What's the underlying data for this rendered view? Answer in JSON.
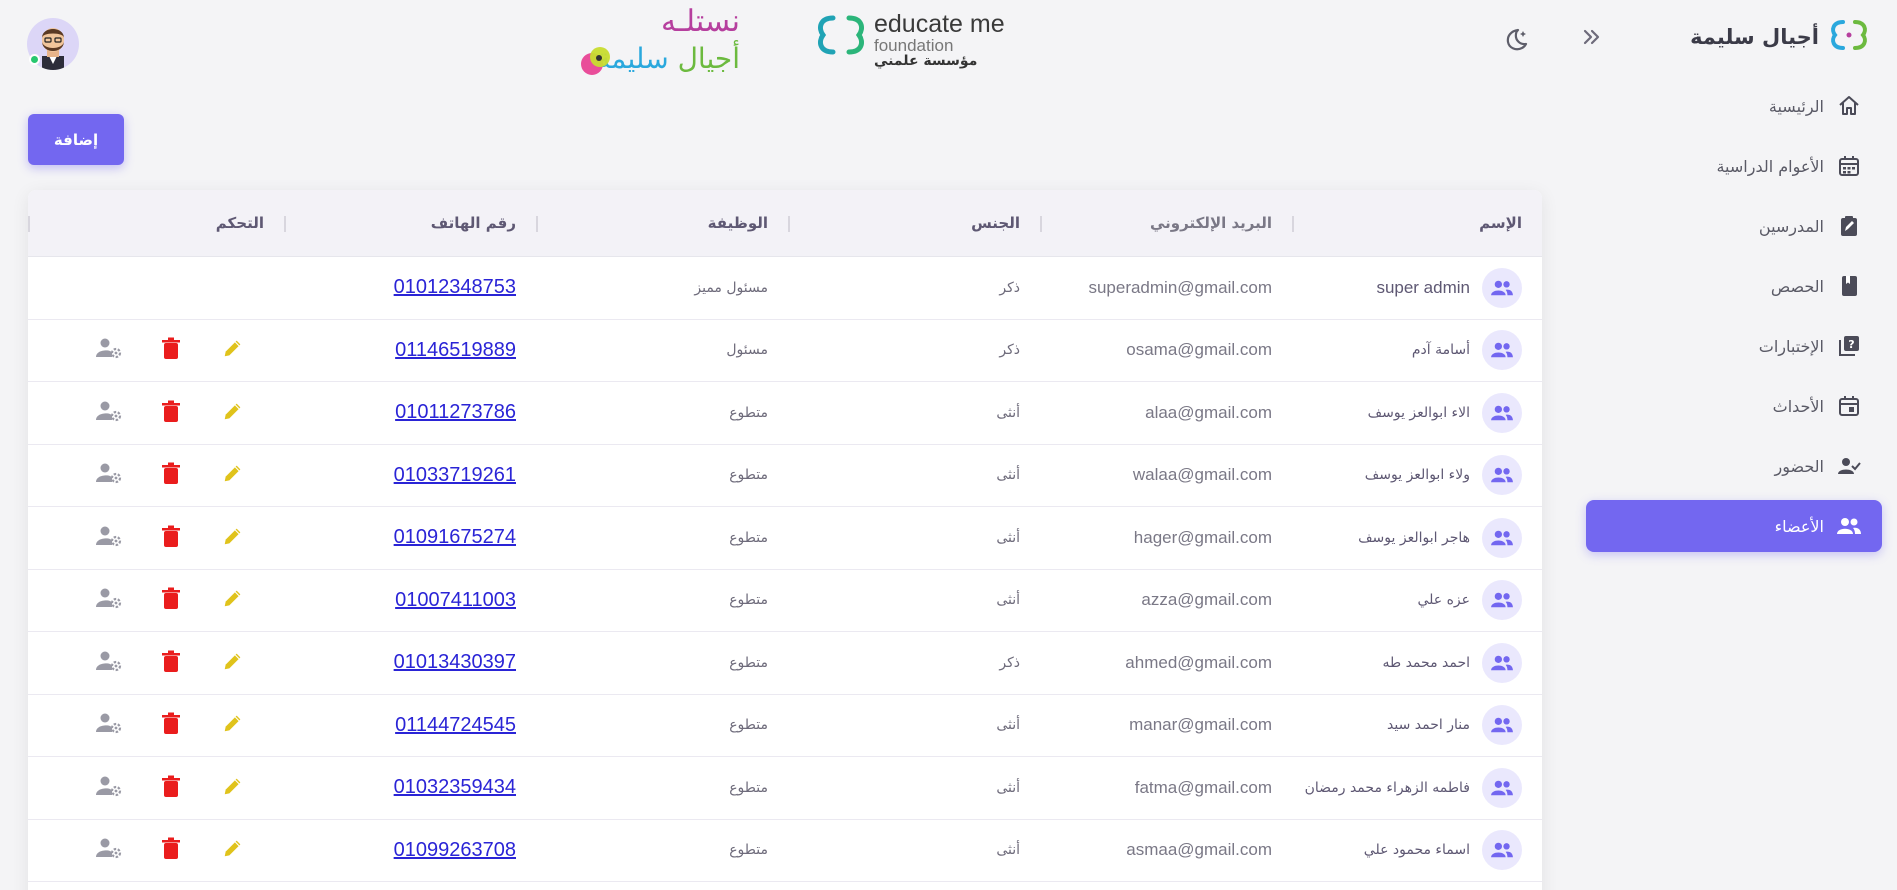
{
  "brand": {
    "name": "أجيال سليمة",
    "logo_icon": "brand-logo-icon"
  },
  "logos": {
    "educate": {
      "line1": "educate me",
      "line2": "foundation",
      "line3": "مؤسسة علمني"
    },
    "nistila": {
      "top": "نستلـه",
      "bottom_green": "أجيال",
      "bottom_blue": "سليمة"
    }
  },
  "nav": {
    "items": [
      {
        "label": "الرئيسية",
        "icon": "home-icon",
        "active": false
      },
      {
        "label": "الأعوام الدراسية",
        "icon": "calendar-icon",
        "active": false
      },
      {
        "label": "المدرسين",
        "icon": "clipboard-edit-icon",
        "active": false
      },
      {
        "label": "الحصص",
        "icon": "book-icon",
        "active": false
      },
      {
        "label": "الإختبارات",
        "icon": "quiz-icon",
        "active": false
      },
      {
        "label": "الأحداث",
        "icon": "event-icon",
        "active": false
      },
      {
        "label": "الحضور",
        "icon": "user-check-icon",
        "active": false
      },
      {
        "label": "الأعضاء",
        "icon": "group-icon",
        "active": true
      }
    ]
  },
  "toolbar": {
    "add_label": "إضافة"
  },
  "colors": {
    "accent": "#7367f0",
    "edit": "#e0c31b",
    "delete": "#ea1d1d",
    "settings": "#9a9aa5",
    "online": "#28c76f"
  },
  "table": {
    "columns": [
      "الإسم",
      "البريد الإلكتروني",
      "الجنس",
      "الوظيفة",
      "رقم الهاتف",
      "التحكم"
    ],
    "rows": [
      {
        "name": "super admin",
        "email": "superadmin@gmail.com",
        "gender": "ذكر",
        "job": "مسئول مميز",
        "phone": "01012348753",
        "controls": false
      },
      {
        "name": "أسامة آدم",
        "email": "osama@gmail.com",
        "gender": "ذكر",
        "job": "مسئول",
        "phone": "01146519889",
        "controls": true
      },
      {
        "name": "الاء ابوالعز يوسف",
        "email": "alaa@gmail.com",
        "gender": "أنثى",
        "job": "متطوع",
        "phone": "01011273786",
        "controls": true
      },
      {
        "name": "ولاء ابوالعز يوسف",
        "email": "walaa@gmail.com",
        "gender": "أنثى",
        "job": "متطوع",
        "phone": "01033719261",
        "controls": true
      },
      {
        "name": "هاجر ابوالعز يوسف",
        "email": "hager@gmail.com",
        "gender": "أنثى",
        "job": "متطوع",
        "phone": "01091675274",
        "controls": true
      },
      {
        "name": "عزه علي",
        "email": "azza@gmail.com",
        "gender": "أنثى",
        "job": "متطوع",
        "phone": "01007411003",
        "controls": true
      },
      {
        "name": "احمد محمد طه",
        "email": "ahmed@gmail.com",
        "gender": "ذكر",
        "job": "متطوع",
        "phone": "01013430397",
        "controls": true
      },
      {
        "name": "منار احمد سيد",
        "email": "manar@gmail.com",
        "gender": "أنثى",
        "job": "متطوع",
        "phone": "01144724545",
        "controls": true
      },
      {
        "name": "فاطمه الزهراء محمد رمضان",
        "email": "fatma@gmail.com",
        "gender": "أنثى",
        "job": "متطوع",
        "phone": "01032359434",
        "controls": true
      },
      {
        "name": "اسماء محمود علي",
        "email": "asmaa@gmail.com",
        "gender": "أنثى",
        "job": "متطوع",
        "phone": "01099263708",
        "controls": true
      }
    ]
  }
}
